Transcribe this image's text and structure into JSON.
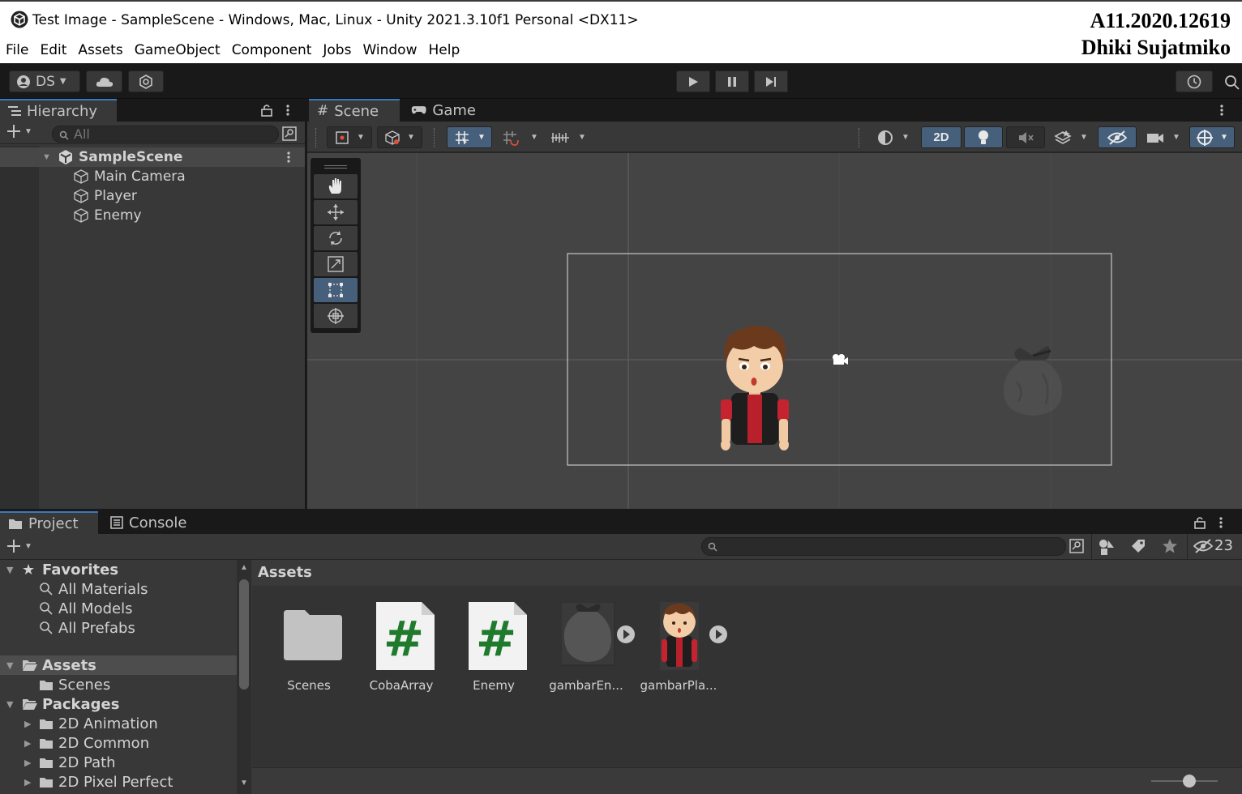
{
  "window": {
    "title": "Test Image - SampleScene - Windows, Mac, Linux - Unity 2021.3.10f1 Personal <DX11>",
    "watermark_line1": "A11.2020.12619",
    "watermark_line2": "Dhiki Sujatmiko"
  },
  "menu": [
    "File",
    "Edit",
    "Assets",
    "GameObject",
    "Component",
    "Jobs",
    "Window",
    "Help"
  ],
  "toolbar": {
    "account_label": "DS",
    "icons": [
      "account-icon",
      "cloud-icon",
      "collab-icon",
      "play-icon",
      "pause-icon",
      "step-icon",
      "history-icon",
      "search-icon"
    ]
  },
  "hierarchy": {
    "tab_label": "Hierarchy",
    "search_placeholder": "All",
    "scene_name": "SampleScene",
    "items": [
      "Main Camera",
      "Player",
      "Enemy"
    ]
  },
  "scene": {
    "tabs": [
      "Scene",
      "Game"
    ],
    "mode_2d_label": "2D",
    "active_tool": "rect-tool",
    "tools": [
      "hand-tool",
      "move-tool",
      "rotate-tool",
      "scale-tool",
      "rect-tool",
      "transform-tool"
    ]
  },
  "project": {
    "tabs": [
      "Project",
      "Console"
    ],
    "hidden_count": "23",
    "favorites_label": "Favorites",
    "favorites": [
      "All Materials",
      "All Models",
      "All Prefabs"
    ],
    "assets_label": "Assets",
    "assets_children": [
      "Scenes"
    ],
    "packages_label": "Packages",
    "packages": [
      "2D Animation",
      "2D Common",
      "2D Path",
      "2D Pixel Perfect"
    ],
    "breadcrumb": "Assets",
    "items": [
      {
        "name": "Scenes",
        "type": "folder"
      },
      {
        "name": "CobaArray",
        "type": "script"
      },
      {
        "name": "Enemy",
        "type": "script"
      },
      {
        "name": "gambarEn...",
        "type": "sprite-enemy"
      },
      {
        "name": "gambarPla...",
        "type": "sprite-player"
      }
    ]
  },
  "colors": {
    "accent": "#3a79bb",
    "selected_tool": "#46607c",
    "script_hash": "#1f7a2c"
  }
}
